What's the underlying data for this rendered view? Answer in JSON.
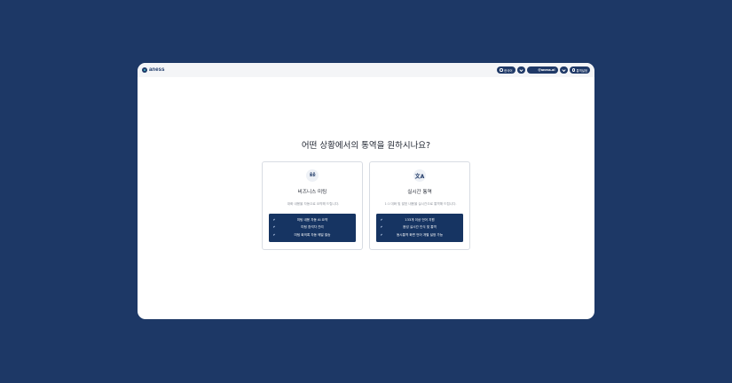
{
  "header": {
    "logo_text": "aness",
    "language_label": "한국어",
    "account_label": "@aness.ai",
    "settings_label": "통역설정"
  },
  "main": {
    "heading": "어떤 상황에서의 통역을 원하시나요?"
  },
  "cards": [
    {
      "icon": "people-group-icon",
      "title": "비즈니스 미팅",
      "description": "대화 내용을 자동으로 요약해 드립니다.",
      "features": [
        "미팅 내용 자동 AI 요약",
        "미팅 참석자 관리",
        "미팅 회의록 자동 메일 발송"
      ]
    },
    {
      "icon": "translate-icon",
      "title": "실시간 통역",
      "description": "1:1 대화 및 발표 내용을 실시간으로 통역해 드립니다.",
      "features": [
        "133개 이상 언어 지원",
        "음성 실시간 인식 및 통역",
        "동시통역 화면 언어 개별 설정 가능"
      ]
    }
  ],
  "colors": {
    "background": "#1d3866",
    "accent": "#163462",
    "topbar": "#f4f5f7"
  }
}
